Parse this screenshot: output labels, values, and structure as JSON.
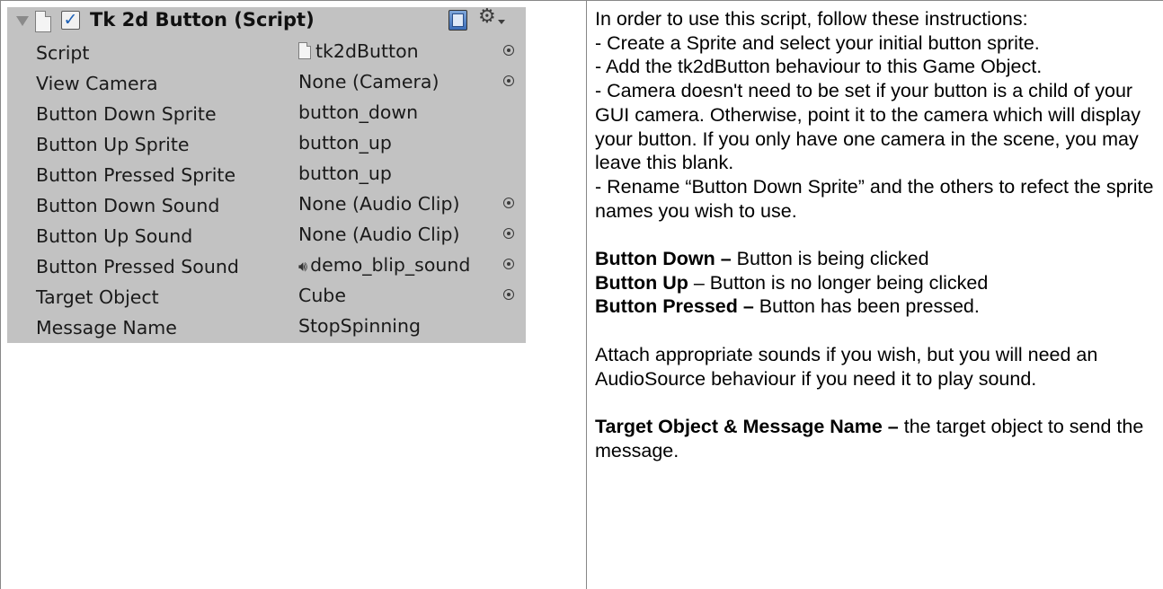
{
  "inspector": {
    "title": "Tk 2d Button (Script)",
    "fields": [
      {
        "label": "Script",
        "value": "tk2dButton",
        "icon": "script-file-icon",
        "picker": true
      },
      {
        "label": "View Camera",
        "value": "None (Camera)",
        "picker": true
      },
      {
        "label": "Button Down Sprite",
        "value": "button_down",
        "picker": false
      },
      {
        "label": "Button Up Sprite",
        "value": "button_up",
        "picker": false
      },
      {
        "label": "Button Pressed Sprite",
        "value": "button_up",
        "picker": false
      },
      {
        "label": "Button Down Sound",
        "value": "None (Audio Clip)",
        "picker": true
      },
      {
        "label": "Button Up Sound",
        "value": "None (Audio Clip)",
        "picker": true
      },
      {
        "label": "Button Pressed Sound",
        "value": "demo_blip_sound",
        "icon": "speaker-icon",
        "picker": true
      },
      {
        "label": "Target Object",
        "value": "Cube",
        "picker": true
      },
      {
        "label": "Message Name",
        "value": "StopSpinning",
        "picker": false
      }
    ]
  },
  "docs": {
    "intro": "In order to use this script, follow these instructions:",
    "steps": [
      "- Create a Sprite and select your initial button sprite.",
      "- Add the tk2dButton behaviour to this Game Object.",
      "- Camera doesn't need to be set if your button is a child of your GUI camera. Otherwise, point it to the camera which will display your button. If you only have one camera in the scene, you may leave this blank.",
      "- Rename “Button Down Sprite” and the others to refect the sprite names you wish to use."
    ],
    "states": [
      {
        "term": "Button Down –",
        "desc": " Button is being clicked"
      },
      {
        "term": "Button Up",
        "desc": " – Button is no longer being clicked"
      },
      {
        "term": "Button Pressed –",
        "desc": " Button has been pressed."
      }
    ],
    "sounds": "Attach appropriate sounds if you wish, but you will need an AudioSource behaviour if you need it to play sound.",
    "target_term": "Target Object & Message Name –",
    "target_desc": " the target object to send the message."
  }
}
